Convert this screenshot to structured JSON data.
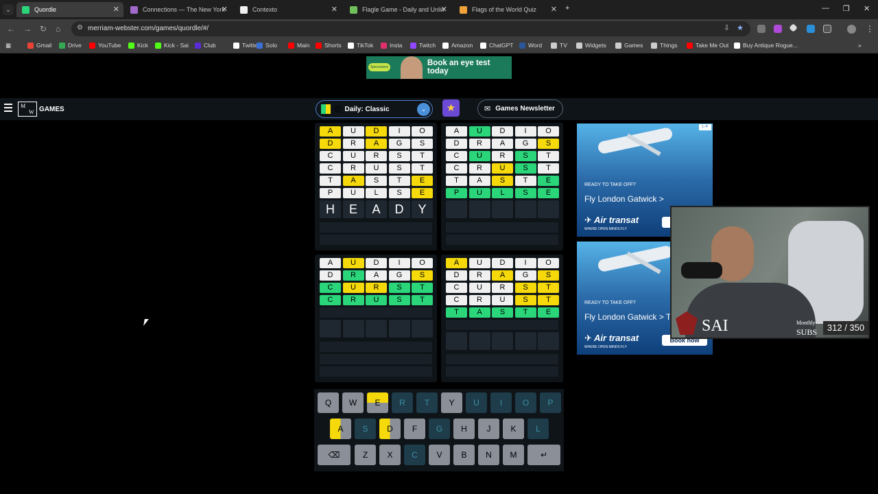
{
  "tabs": [
    {
      "title": "Quordle",
      "active": true,
      "color": "#2bd67b"
    },
    {
      "title": "Connections — The New York T",
      "active": false,
      "color": "#a06acd"
    },
    {
      "title": "Contexto",
      "active": false,
      "color": "#f0f0f0"
    },
    {
      "title": "Flagle Game - Daily and Unlim",
      "active": false,
      "color": "#6fbf5b"
    },
    {
      "title": "Flags of the World Quiz",
      "active": false,
      "color": "#f0a23a"
    }
  ],
  "address": {
    "url": "merriam-webster.com/games/quordle/#/"
  },
  "bookmarks": [
    {
      "label": "Gmail",
      "color": "#ea4335"
    },
    {
      "label": "Drive",
      "color": "#34a853"
    },
    {
      "label": "YouTube",
      "color": "#ff0000"
    },
    {
      "label": "Kick",
      "color": "#53fc18"
    },
    {
      "label": "Kick - Sai",
      "color": "#53fc18"
    },
    {
      "label": "Club",
      "color": "#5b2bd6"
    },
    {
      "label": "Twitter",
      "color": "#ffffff"
    },
    {
      "label": "Solo",
      "color": "#3b6fd6"
    },
    {
      "label": "Main",
      "color": "#ff0000"
    },
    {
      "label": "Shorts",
      "color": "#ff0000"
    },
    {
      "label": "TikTok",
      "color": "#ffffff"
    },
    {
      "label": "Insta",
      "color": "#e1306c"
    },
    {
      "label": "Twitch",
      "color": "#9146ff"
    },
    {
      "label": "Amazon",
      "color": "#ffffff"
    },
    {
      "label": "ChatGPT",
      "color": "#ffffff"
    },
    {
      "label": "Word",
      "color": "#2b579a"
    },
    {
      "label": "TV",
      "color": "#cccccc"
    },
    {
      "label": "Widgets",
      "color": "#cccccc"
    },
    {
      "label": "Games",
      "color": "#cccccc"
    },
    {
      "label": "Things",
      "color": "#cccccc"
    },
    {
      "label": "Take Me Out",
      "color": "#ff0000"
    },
    {
      "label": "Buy Antique Rogue...",
      "color": "#ffffff"
    }
  ],
  "ad_top": {
    "brand": "Specsavers",
    "text": "Book an eye test today"
  },
  "gamebar": {
    "logo_letters": "MW",
    "logo_label": "GAMES",
    "mode": "Daily: Classic",
    "mode_emoji": "😊",
    "newsletter": "Games Newsletter"
  },
  "boards": [
    {
      "rows": [
        {
          "letters": [
            "A",
            "U",
            "D",
            "I",
            "O"
          ],
          "states": [
            "y",
            "w",
            "y",
            "w",
            "w"
          ]
        },
        {
          "letters": [
            "D",
            "R",
            "A",
            "G",
            "S"
          ],
          "states": [
            "y",
            "w",
            "y",
            "w",
            "w"
          ]
        },
        {
          "letters": [
            "C",
            "U",
            "R",
            "S",
            "T"
          ],
          "states": [
            "w",
            "w",
            "w",
            "w",
            "w"
          ]
        },
        {
          "letters": [
            "C",
            "R",
            "U",
            "S",
            "T"
          ],
          "states": [
            "w",
            "w",
            "w",
            "w",
            "w"
          ]
        },
        {
          "letters": [
            "T",
            "A",
            "S",
            "T",
            "E"
          ],
          "states": [
            "w",
            "y",
            "w",
            "w",
            "y"
          ]
        },
        {
          "letters": [
            "P",
            "U",
            "L",
            "S",
            "E"
          ],
          "states": [
            "w",
            "w",
            "w",
            "w",
            "y"
          ]
        }
      ],
      "typed": [
        "H",
        "E",
        "A",
        "D",
        "Y"
      ],
      "empty_rows": 2
    },
    {
      "rows": [
        {
          "letters": [
            "A",
            "U",
            "D",
            "I",
            "O"
          ],
          "states": [
            "w",
            "g",
            "w",
            "w",
            "w"
          ]
        },
        {
          "letters": [
            "D",
            "R",
            "A",
            "G",
            "S"
          ],
          "states": [
            "w",
            "w",
            "w",
            "w",
            "y"
          ]
        },
        {
          "letters": [
            "C",
            "U",
            "R",
            "S",
            "T"
          ],
          "states": [
            "w",
            "g",
            "w",
            "g",
            "w"
          ]
        },
        {
          "letters": [
            "C",
            "R",
            "U",
            "S",
            "T"
          ],
          "states": [
            "w",
            "w",
            "y",
            "g",
            "w"
          ]
        },
        {
          "letters": [
            "T",
            "A",
            "S",
            "T",
            "E"
          ],
          "states": [
            "w",
            "w",
            "y",
            "w",
            "g"
          ]
        },
        {
          "letters": [
            "P",
            "U",
            "L",
            "S",
            "E"
          ],
          "states": [
            "g",
            "g",
            "g",
            "g",
            "g"
          ]
        }
      ],
      "typed": [],
      "empty_rows": 3
    },
    {
      "rows": [
        {
          "letters": [
            "A",
            "U",
            "D",
            "I",
            "O"
          ],
          "states": [
            "w",
            "y",
            "w",
            "w",
            "w"
          ]
        },
        {
          "letters": [
            "D",
            "R",
            "A",
            "G",
            "S"
          ],
          "states": [
            "w",
            "g",
            "w",
            "w",
            "y"
          ]
        },
        {
          "letters": [
            "C",
            "U",
            "R",
            "S",
            "T"
          ],
          "states": [
            "g",
            "y",
            "y",
            "g",
            "g"
          ]
        },
        {
          "letters": [
            "C",
            "R",
            "U",
            "S",
            "T"
          ],
          "states": [
            "g",
            "g",
            "g",
            "g",
            "g"
          ]
        }
      ],
      "typed": [],
      "empty_rows": 5
    },
    {
      "rows": [
        {
          "letters": [
            "A",
            "U",
            "D",
            "I",
            "O"
          ],
          "states": [
            "y",
            "w",
            "w",
            "w",
            "w"
          ]
        },
        {
          "letters": [
            "D",
            "R",
            "A",
            "G",
            "S"
          ],
          "states": [
            "w",
            "w",
            "y",
            "w",
            "y"
          ]
        },
        {
          "letters": [
            "C",
            "U",
            "R",
            "S",
            "T"
          ],
          "states": [
            "w",
            "w",
            "w",
            "y",
            "y"
          ]
        },
        {
          "letters": [
            "C",
            "R",
            "U",
            "S",
            "T"
          ],
          "states": [
            "w",
            "w",
            "w",
            "y",
            "y"
          ]
        },
        {
          "letters": [
            "T",
            "A",
            "S",
            "T",
            "E"
          ],
          "states": [
            "g",
            "g",
            "g",
            "g",
            "g"
          ]
        }
      ],
      "typed": [],
      "empty_rows": 4
    }
  ],
  "keyboard": {
    "rows": [
      [
        {
          "k": "Q",
          "s": "n"
        },
        {
          "k": "W",
          "s": "n"
        },
        {
          "k": "E",
          "s": "h"
        },
        {
          "k": "R",
          "s": "u"
        },
        {
          "k": "T",
          "s": "u"
        },
        {
          "k": "Y",
          "s": "n"
        },
        {
          "k": "U",
          "s": "u"
        },
        {
          "k": "I",
          "s": "u"
        },
        {
          "k": "O",
          "s": "u"
        },
        {
          "k": "P",
          "s": "u"
        }
      ],
      [
        {
          "k": "A",
          "s": "h2"
        },
        {
          "k": "S",
          "s": "u"
        },
        {
          "k": "D",
          "s": "h2"
        },
        {
          "k": "F",
          "s": "n"
        },
        {
          "k": "G",
          "s": "u"
        },
        {
          "k": "H",
          "s": "n"
        },
        {
          "k": "J",
          "s": "n"
        },
        {
          "k": "K",
          "s": "n"
        },
        {
          "k": "L",
          "s": "u"
        }
      ],
      [
        {
          "k": "⌫",
          "s": "back"
        },
        {
          "k": "Z",
          "s": "n"
        },
        {
          "k": "X",
          "s": "n"
        },
        {
          "k": "C",
          "s": "u"
        },
        {
          "k": "V",
          "s": "n"
        },
        {
          "k": "B",
          "s": "n"
        },
        {
          "k": "N",
          "s": "n"
        },
        {
          "k": "M",
          "s": "n"
        },
        {
          "k": "↵",
          "s": "enter"
        }
      ]
    ]
  },
  "ads_right": [
    {
      "ready": "READY TO TAKE OFF?",
      "dest": "Fly London Gatwick >",
      "brand": "Air transat",
      "slogan": "WHERE OPEN MINDS FLY",
      "book": "Bo"
    },
    {
      "ready": "READY TO TAKE OFF?",
      "dest": "Fly London Gatwick > Toronto",
      "brand": "Air transat",
      "slogan": "WHERE OPEN MINDS FLY",
      "book": "Book now"
    }
  ],
  "webcam": {
    "name": "SAI",
    "monthly": "Monthly",
    "subs": "SUBS",
    "count": "312 / 350"
  }
}
